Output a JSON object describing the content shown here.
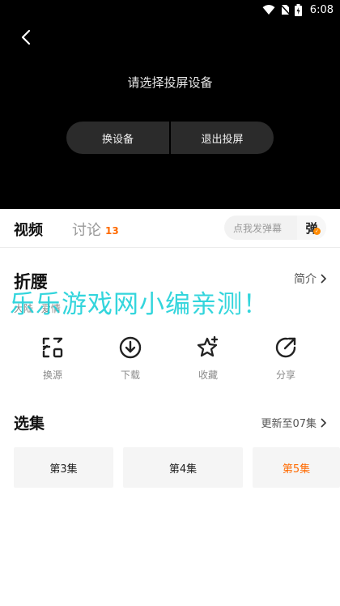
{
  "status_bar": {
    "time": "6:08"
  },
  "player": {
    "cast_title": "请选择投屏设备",
    "switch_device_label": "换设备",
    "exit_cast_label": "退出投屏"
  },
  "tabs": {
    "video_label": "视频",
    "discuss_label": "讨论",
    "discuss_count": "13",
    "danmu_placeholder": "点我发弹幕",
    "danmu_button": "弹"
  },
  "show": {
    "title": "折腰",
    "intro_label": "简介",
    "tags": [
      "大陆",
      "爱情"
    ]
  },
  "watermark": "乐乐游戏网小编亲测！",
  "actions": [
    {
      "label": "换源",
      "icon": "switch-source-icon"
    },
    {
      "label": "下载",
      "icon": "download-icon"
    },
    {
      "label": "收藏",
      "icon": "star-icon"
    },
    {
      "label": "分享",
      "icon": "share-icon"
    }
  ],
  "episodes": {
    "title": "选集",
    "update_text": "更新至07集",
    "items": [
      {
        "label": "第3集",
        "active": false
      },
      {
        "label": "第4集",
        "active": false
      },
      {
        "label": "第5集",
        "active": true
      }
    ]
  },
  "colors": {
    "accent": "#ff6a00",
    "watermark": "#18d0d8"
  }
}
